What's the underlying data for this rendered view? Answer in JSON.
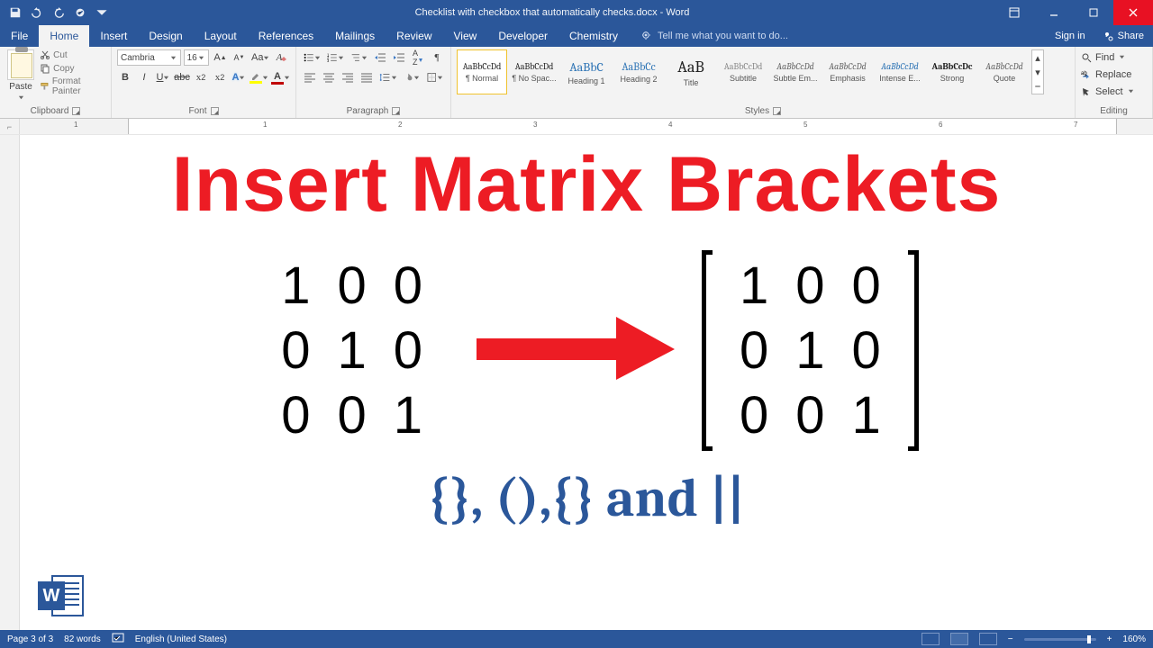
{
  "titlebar": {
    "doc_title": "Checklist with checkbox that automatically checks.docx - Word"
  },
  "tabs": {
    "file": "File",
    "items": [
      "Home",
      "Insert",
      "Design",
      "Layout",
      "References",
      "Mailings",
      "Review",
      "View",
      "Developer",
      "Chemistry"
    ],
    "active_index": 0,
    "tellme": "Tell me what you want to do...",
    "signin": "Sign in",
    "share": "Share"
  },
  "ribbon": {
    "clipboard": {
      "label": "Clipboard",
      "paste": "Paste",
      "cut": "Cut",
      "copy": "Copy",
      "format_painter": "Format Painter"
    },
    "font": {
      "label": "Font",
      "name": "Cambria",
      "size": "16"
    },
    "paragraph": {
      "label": "Paragraph"
    },
    "styles": {
      "label": "Styles",
      "items": [
        {
          "preview": "AaBbCcDd",
          "label": "¶ Normal",
          "sel": true,
          "cls": ""
        },
        {
          "preview": "AaBbCcDd",
          "label": "¶ No Spac...",
          "cls": ""
        },
        {
          "preview": "AaBbC",
          "label": "Heading 1",
          "cls": "h1"
        },
        {
          "preview": "AaBbCc",
          "label": "Heading 2",
          "cls": "h2"
        },
        {
          "preview": "AaB",
          "label": "Title",
          "cls": "title"
        },
        {
          "preview": "AaBbCcDd",
          "label": "Subtitle",
          "cls": "sub"
        },
        {
          "preview": "AaBbCcDd",
          "label": "Subtle Em...",
          "cls": "ita"
        },
        {
          "preview": "AaBbCcDd",
          "label": "Emphasis",
          "cls": "ita"
        },
        {
          "preview": "AaBbCcDd",
          "label": "Intense E...",
          "cls": "int"
        },
        {
          "preview": "AaBbCcDc",
          "label": "Strong",
          "cls": "bold"
        },
        {
          "preview": "AaBbCcDd",
          "label": "Quote",
          "cls": "ita"
        }
      ]
    },
    "editing": {
      "label": "Editing",
      "find": "Find",
      "replace": "Replace",
      "select": "Select"
    }
  },
  "ruler": {
    "numbers": [
      "1",
      "1",
      "2",
      "3",
      "4",
      "5",
      "6",
      "7"
    ]
  },
  "document": {
    "headline": "Insert Matrix Brackets",
    "matrix": [
      [
        "1",
        "0",
        "0"
      ],
      [
        "0",
        "1",
        "0"
      ],
      [
        "0",
        "0",
        "1"
      ]
    ],
    "subline": "{}, (),{} and ||"
  },
  "status": {
    "page": "Page 3 of 3",
    "words": "82 words",
    "lang": "English (United States)",
    "zoom": "160%"
  }
}
